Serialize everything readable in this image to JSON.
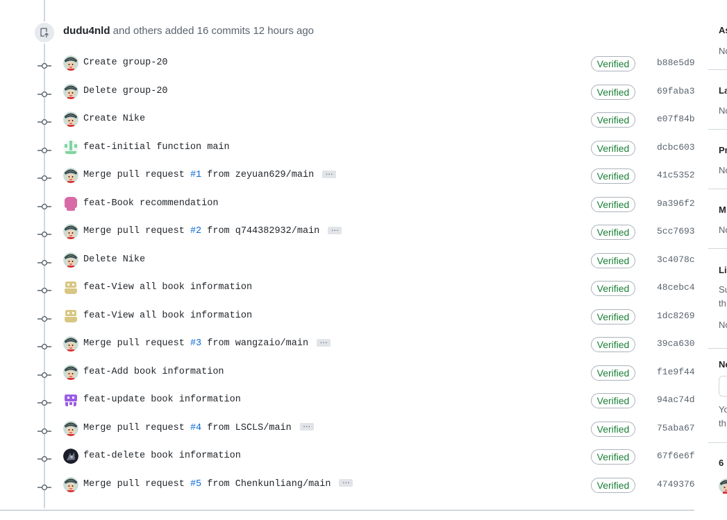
{
  "header": {
    "author": "dudu4nld",
    "summary": "and others added 16 commits 12 hours ago"
  },
  "commits": [
    {
      "message": "Create group-20",
      "sha": "b88e5d9",
      "verified": "Verified",
      "avatar": "crayon-shin-chan-avatar"
    },
    {
      "message": "Delete group-20",
      "sha": "69faba3",
      "verified": "Verified",
      "avatar": "crayon-shin-chan-avatar"
    },
    {
      "message": "Create Nike",
      "sha": "e07f84b",
      "verified": "Verified",
      "avatar": "crayon-shin-chan-avatar"
    },
    {
      "message": "feat-initial function main",
      "sha": "dcbc603",
      "verified": "Verified",
      "avatar": "green-identicon-avatar"
    },
    {
      "message_prefix": "Merge pull request ",
      "pr": "#1",
      "message_suffix": " from zeyuan629/main",
      "sha": "41c5352",
      "verified": "Verified",
      "avatar": "crayon-shin-chan-avatar",
      "expand": "…"
    },
    {
      "message": "feat-Book recommendation",
      "sha": "9a396f2",
      "verified": "Verified",
      "avatar": "pink-identicon-avatar"
    },
    {
      "message_prefix": "Merge pull request ",
      "pr": "#2",
      "message_suffix": " from q744382932/main",
      "sha": "5cc7693",
      "verified": "Verified",
      "avatar": "crayon-shin-chan-avatar",
      "expand": "…"
    },
    {
      "message": "Delete Nike",
      "sha": "3c4078c",
      "verified": "Verified",
      "avatar": "crayon-shin-chan-avatar"
    },
    {
      "message": "feat-View all book information",
      "sha": "48cebc4",
      "verified": "Verified",
      "avatar": "tan-identicon-avatar"
    },
    {
      "message": "feat-View all book information",
      "sha": "1dc8269",
      "verified": "Verified",
      "avatar": "tan-identicon-avatar"
    },
    {
      "message_prefix": "Merge pull request ",
      "pr": "#3",
      "message_suffix": " from wangzaio/main",
      "sha": "39ca630",
      "verified": "Verified",
      "avatar": "crayon-shin-chan-avatar",
      "expand": "…"
    },
    {
      "message": "feat-Add book information",
      "sha": "f1e9f44",
      "verified": "Verified",
      "avatar": "crayon-shin-chan-avatar"
    },
    {
      "message": "feat-update book information",
      "sha": "94ac74d",
      "verified": "Verified",
      "avatar": "purple-identicon-avatar"
    },
    {
      "message_prefix": "Merge pull request ",
      "pr": "#4",
      "message_suffix": " from LSCLS/main",
      "sha": "75aba67",
      "verified": "Verified",
      "avatar": "crayon-shin-chan-avatar",
      "expand": "…"
    },
    {
      "message": "feat-delete book information",
      "sha": "67f6e6f",
      "verified": "Verified",
      "avatar": "dark-photo-avatar"
    },
    {
      "message_prefix": "Merge pull request ",
      "pr": "#5",
      "message_suffix": " from Chenkunliang/main",
      "sha": "4749376",
      "verified": "Verified",
      "avatar": "crayon-shin-chan-avatar",
      "expand": "…"
    }
  ],
  "sidebar": {
    "items": [
      "As",
      "No",
      "La",
      "No",
      "Pr",
      "No",
      "M",
      "No",
      "Lin",
      "Su",
      "th",
      "No",
      "No",
      "Yo",
      "th",
      "6"
    ]
  },
  "colors": {
    "verified_green": "#1a7f37",
    "link_blue": "#0969da",
    "border_gray": "#d0d7de"
  }
}
